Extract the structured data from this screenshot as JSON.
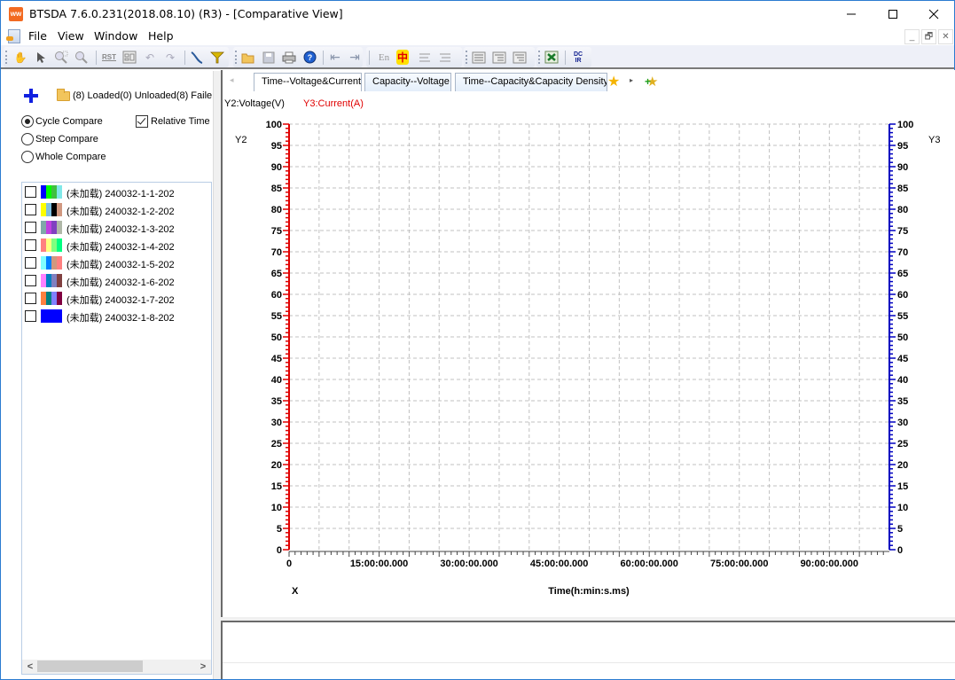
{
  "window": {
    "title": "BTSDA 7.6.0.231(2018.08.10) (R3) - [Comparative View]",
    "app_icon": "btsda-logo-icon",
    "controls": [
      "minimize-icon",
      "maximize-icon",
      "close-icon"
    ]
  },
  "menu": {
    "items": [
      {
        "label": "File"
      },
      {
        "label": "View"
      },
      {
        "label": "Window"
      },
      {
        "label": "Help"
      }
    ],
    "mdi_controls": [
      "_",
      "🗗",
      "✕"
    ]
  },
  "toolbar": {
    "group1": [
      "hand-pan-icon",
      "pointer-icon",
      "zoom-box-icon",
      "zoom-icon",
      "reset-icon",
      "layout-icon",
      "undo-icon",
      "redo-icon",
      "curve-icon",
      "filter-icon"
    ],
    "group2": [
      "open-folder-icon",
      "save-icon",
      "print-icon",
      "help-icon",
      "back-icon",
      "forward-icon",
      "english-icon",
      "chinese-icon",
      "align-left-icon",
      "align-right-icon"
    ],
    "group3": [
      "list-view-icon",
      "detail-view-icon",
      "tree-view-icon"
    ],
    "group4": [
      "excel-export-icon",
      "dcir-icon"
    ],
    "labels": {
      "reset": "RST",
      "english": "En",
      "chinese": "中",
      "dcir": "DC IR"
    }
  },
  "left_panel": {
    "load_status": "(8)  Loaded(0)  Unloaded(8)  Faile",
    "compare_modes": [
      {
        "label": "Cycle Compare",
        "selected": true
      },
      {
        "label": "Step Compare",
        "selected": false
      },
      {
        "label": "Whole Compare",
        "selected": false
      }
    ],
    "relative_time": {
      "label": "Relative Time",
      "checked": true
    },
    "files": [
      {
        "label": "(未加载) 240032-1-1-202",
        "checked": false,
        "colors": [
          "#0000ff",
          "#00ff00",
          "#40c040",
          "#80e8e8"
        ]
      },
      {
        "label": "(未加载) 240032-1-2-202",
        "checked": false,
        "colors": [
          "#ffff00",
          "#80c0e0",
          "#000000",
          "#d09880"
        ]
      },
      {
        "label": "(未加载) 240032-1-3-202",
        "checked": false,
        "colors": [
          "#80a8a8",
          "#c040e0",
          "#8040c0",
          "#b0b8a8"
        ]
      },
      {
        "label": "(未加载) 240032-1-4-202",
        "checked": false,
        "colors": [
          "#ff8080",
          "#ffff80",
          "#80ff80",
          "#00ff80"
        ]
      },
      {
        "label": "(未加载) 240032-1-5-202",
        "checked": false,
        "colors": [
          "#80ffff",
          "#0080ff",
          "#d09880",
          "#ff8080"
        ]
      },
      {
        "label": "(未加载) 240032-1-6-202",
        "checked": false,
        "colors": [
          "#ff80ff",
          "#0080c0",
          "#8080c0",
          "#804040"
        ]
      },
      {
        "label": "(未加载) 240032-1-7-202",
        "checked": false,
        "colors": [
          "#ff8040",
          "#008080",
          "#8080ff",
          "#800040"
        ]
      },
      {
        "label": "(未加载) 240032-1-8-202",
        "checked": false,
        "colors": [
          "#0000ff"
        ]
      }
    ],
    "scroll": {
      "left": "<",
      "right": ">"
    }
  },
  "tabs": {
    "items": [
      {
        "label": "Time--Voltage&Current",
        "active": true
      },
      {
        "label": "Capacity--Voltage",
        "active": false
      },
      {
        "label": "Time--Capacity&Capacity Density",
        "active": false
      }
    ],
    "prev_icon": "◂",
    "next_icon": "▸",
    "star_icon": "★",
    "add_icon": "★"
  },
  "chart_data": {
    "type": "line",
    "series": [],
    "legend": [
      {
        "name": "Y2:Voltage(V)",
        "color": "#000000"
      },
      {
        "name": "Y3:Current(A)",
        "color": "#e00000"
      }
    ],
    "y2_label": "Y2",
    "y3_label": "Y3",
    "xlabel": "Time(h:min:s.ms)",
    "x_axis_name": "X",
    "xlim_hours": [
      0,
      100
    ],
    "x_tick_labels": [
      "0",
      "15:00:00.000",
      "30:00:00.000",
      "45:00:00.000",
      "60:00:00.000",
      "75:00:00.000",
      "90:00:00.000"
    ],
    "x_tick_values_hours": [
      0,
      15,
      30,
      45,
      60,
      75,
      90
    ],
    "x_grid_step_hours": 5,
    "y2_lim": [
      0,
      100
    ],
    "y3_lim": [
      0,
      100
    ],
    "y_tick_step": 5,
    "y_tick_labels": [
      "0",
      "5",
      "10",
      "15",
      "20",
      "25",
      "30",
      "35",
      "40",
      "45",
      "50",
      "55",
      "60",
      "65",
      "70",
      "75",
      "80",
      "85",
      "90",
      "95",
      "100"
    ],
    "grid": true,
    "colors": {
      "y2_axis": "#e00000",
      "y3_axis": "#0000c0",
      "grid": "#c0c0c0"
    }
  }
}
